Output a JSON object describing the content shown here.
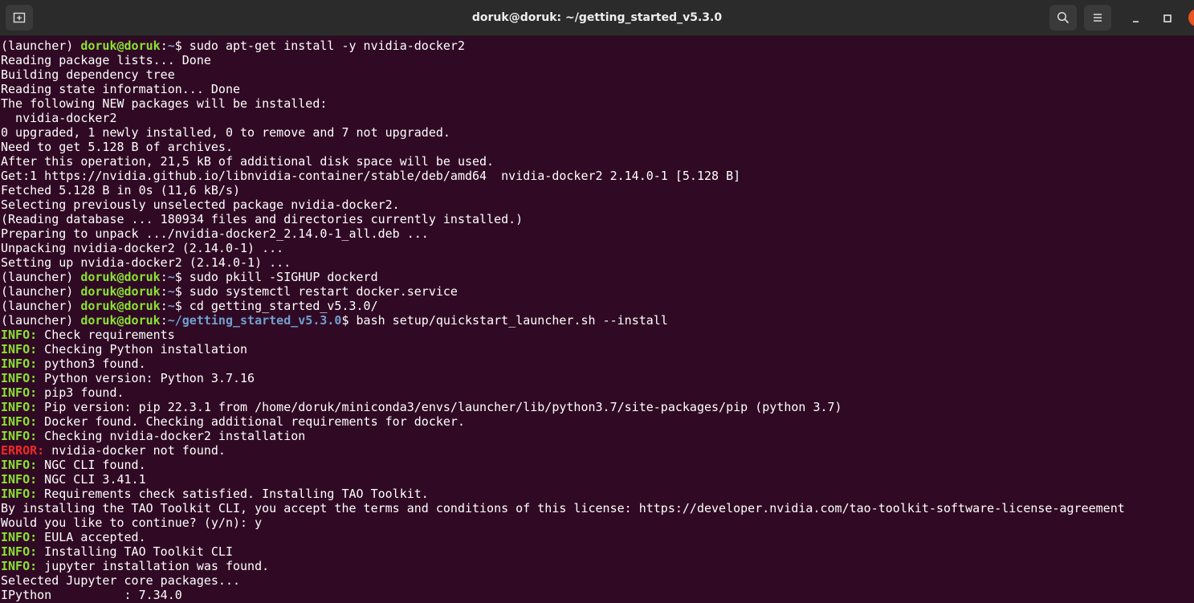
{
  "window": {
    "title": "doruk@doruk: ~/getting_started_v5.3.0",
    "icons": {
      "new_tab": "new-tab-icon",
      "search": "search-icon",
      "menu": "hamburger-menu-icon",
      "minimize": "minimize-icon",
      "maximize": "maximize-icon",
      "close": "close-icon"
    }
  },
  "colors": {
    "background": "#300a24",
    "text": "#ffffff",
    "user": "#8ae234",
    "path": "#729fcf",
    "info": "#8ae234",
    "error": "#ef2929"
  },
  "terminal": {
    "lines": [
      {
        "type": "prompt",
        "env": "(launcher) ",
        "user": "doruk@doruk",
        "sep": ":",
        "path": "~",
        "cmd": "$ sudo apt-get install -y nvidia-docker2"
      },
      {
        "type": "plain",
        "text": "Reading package lists... Done"
      },
      {
        "type": "plain",
        "text": "Building dependency tree"
      },
      {
        "type": "plain",
        "text": "Reading state information... Done"
      },
      {
        "type": "plain",
        "text": "The following NEW packages will be installed:"
      },
      {
        "type": "plain",
        "text": "  nvidia-docker2"
      },
      {
        "type": "plain",
        "text": "0 upgraded, 1 newly installed, 0 to remove and 7 not upgraded."
      },
      {
        "type": "plain",
        "text": "Need to get 5.128 B of archives."
      },
      {
        "type": "plain",
        "text": "After this operation, 21,5 kB of additional disk space will be used."
      },
      {
        "type": "plain",
        "text": "Get:1 https://nvidia.github.io/libnvidia-container/stable/deb/amd64  nvidia-docker2 2.14.0-1 [5.128 B]"
      },
      {
        "type": "plain",
        "text": "Fetched 5.128 B in 0s (11,6 kB/s)"
      },
      {
        "type": "plain",
        "text": "Selecting previously unselected package nvidia-docker2."
      },
      {
        "type": "plain",
        "text": "(Reading database ... 180934 files and directories currently installed.)"
      },
      {
        "type": "plain",
        "text": "Preparing to unpack .../nvidia-docker2_2.14.0-1_all.deb ..."
      },
      {
        "type": "plain",
        "text": "Unpacking nvidia-docker2 (2.14.0-1) ..."
      },
      {
        "type": "plain",
        "text": "Setting up nvidia-docker2 (2.14.0-1) ..."
      },
      {
        "type": "prompt",
        "env": "(launcher) ",
        "user": "doruk@doruk",
        "sep": ":",
        "path": "~",
        "cmd": "$ sudo pkill -SIGHUP dockerd"
      },
      {
        "type": "prompt",
        "env": "(launcher) ",
        "user": "doruk@doruk",
        "sep": ":",
        "path": "~",
        "cmd": "$ sudo systemctl restart docker.service"
      },
      {
        "type": "prompt",
        "env": "(launcher) ",
        "user": "doruk@doruk",
        "sep": ":",
        "path": "~",
        "cmd": "$ cd getting_started_v5.3.0/"
      },
      {
        "type": "prompt",
        "env": "(launcher) ",
        "user": "doruk@doruk",
        "sep": ":",
        "path": "~/getting_started_v5.3.0",
        "cmd": "$ bash setup/quickstart_launcher.sh --install"
      },
      {
        "type": "tagged",
        "tag": "INFO:",
        "level": "info",
        "text": " Check requirements"
      },
      {
        "type": "tagged",
        "tag": "INFO:",
        "level": "info",
        "text": " Checking Python installation"
      },
      {
        "type": "tagged",
        "tag": "INFO:",
        "level": "info",
        "text": " python3 found."
      },
      {
        "type": "tagged",
        "tag": "INFO:",
        "level": "info",
        "text": " Python version: Python 3.7.16"
      },
      {
        "type": "tagged",
        "tag": "INFO:",
        "level": "info",
        "text": " pip3 found."
      },
      {
        "type": "tagged",
        "tag": "INFO:",
        "level": "info",
        "text": " Pip version: pip 22.3.1 from /home/doruk/miniconda3/envs/launcher/lib/python3.7/site-packages/pip (python 3.7)"
      },
      {
        "type": "tagged",
        "tag": "INFO:",
        "level": "info",
        "text": " Docker found. Checking additional requirements for docker."
      },
      {
        "type": "tagged",
        "tag": "INFO:",
        "level": "info",
        "text": " Checking nvidia-docker2 installation"
      },
      {
        "type": "tagged",
        "tag": "ERROR:",
        "level": "error",
        "text": " nvidia-docker not found."
      },
      {
        "type": "tagged",
        "tag": "INFO:",
        "level": "info",
        "text": " NGC CLI found."
      },
      {
        "type": "tagged",
        "tag": "INFO:",
        "level": "info",
        "text": " NGC CLI 3.41.1"
      },
      {
        "type": "tagged",
        "tag": "INFO:",
        "level": "info",
        "text": " Requirements check satisfied. Installing TAO Toolkit."
      },
      {
        "type": "plain",
        "text": "By installing the TAO Toolkit CLI, you accept the terms and conditions of this license: https://developer.nvidia.com/tao-toolkit-software-license-agreement"
      },
      {
        "type": "plain",
        "text": "Would you like to continue? (y/n): y"
      },
      {
        "type": "tagged",
        "tag": "INFO:",
        "level": "info",
        "text": " EULA accepted."
      },
      {
        "type": "tagged",
        "tag": "INFO:",
        "level": "info",
        "text": " Installing TAO Toolkit CLI"
      },
      {
        "type": "tagged",
        "tag": "INFO:",
        "level": "info",
        "text": " jupyter installation was found."
      },
      {
        "type": "plain",
        "text": "Selected Jupyter core packages..."
      },
      {
        "type": "plain",
        "text": "IPython          : 7.34.0"
      }
    ]
  }
}
